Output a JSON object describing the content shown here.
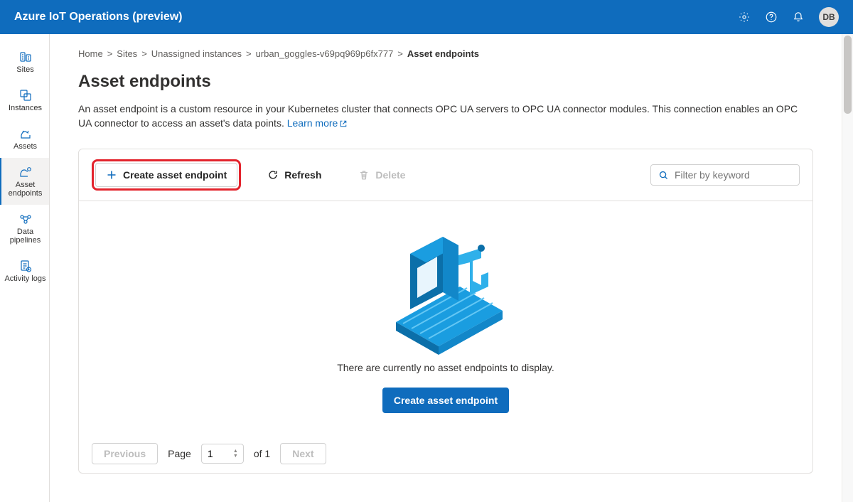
{
  "header": {
    "title": "Azure IoT Operations (preview)",
    "avatar": "DB"
  },
  "sidebar": {
    "items": [
      {
        "label": "Sites"
      },
      {
        "label": "Instances"
      },
      {
        "label": "Assets"
      },
      {
        "label": "Asset endpoints"
      },
      {
        "label": "Data pipelines"
      },
      {
        "label": "Activity logs"
      }
    ]
  },
  "breadcrumbs": {
    "items": [
      "Home",
      "Sites",
      "Unassigned instances",
      "urban_goggles-v69pq969p6fx777"
    ],
    "current": "Asset endpoints"
  },
  "page": {
    "title": "Asset endpoints",
    "desc": "An asset endpoint is a custom resource in your Kubernetes cluster that connects OPC UA servers to OPC UA connector modules. This connection enables an OPC UA connector to access an asset's data points. ",
    "learn_more": "Learn more"
  },
  "toolbar": {
    "create": "Create asset endpoint",
    "refresh": "Refresh",
    "delete": "Delete",
    "search_placeholder": "Filter by keyword"
  },
  "empty": {
    "text": "There are currently no asset endpoints to display.",
    "cta": "Create asset endpoint"
  },
  "pager": {
    "previous": "Previous",
    "page_label": "Page",
    "page_value": "1",
    "of_label": "of 1",
    "next": "Next"
  }
}
